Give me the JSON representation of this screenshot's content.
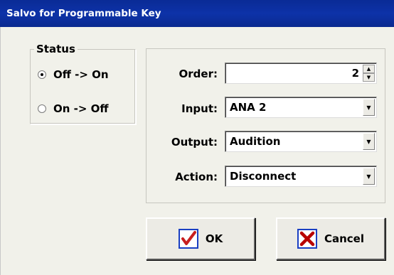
{
  "window": {
    "title": "Salvo for Programmable Key"
  },
  "status": {
    "legend": "Status",
    "options": [
      {
        "label": "Off -> On",
        "checked": true
      },
      {
        "label": "On -> Off",
        "checked": false
      }
    ]
  },
  "fields": {
    "order": {
      "label": "Order:",
      "value": "2"
    },
    "input": {
      "label": "Input:",
      "value": "ANA 2"
    },
    "output": {
      "label": "Output:",
      "value": "Audition"
    },
    "action": {
      "label": "Action:",
      "value": "Disconnect"
    }
  },
  "buttons": {
    "ok": {
      "label": "OK",
      "icon": "check-icon"
    },
    "cancel": {
      "label": "Cancel",
      "icon": "x-icon"
    }
  },
  "colors": {
    "titlebar": "#0c2fa1",
    "dialog_bg": "#f1f1ea",
    "check_blue": "#1a3fc2",
    "check_red": "#c81e1e",
    "cancel_red": "#b80000"
  }
}
